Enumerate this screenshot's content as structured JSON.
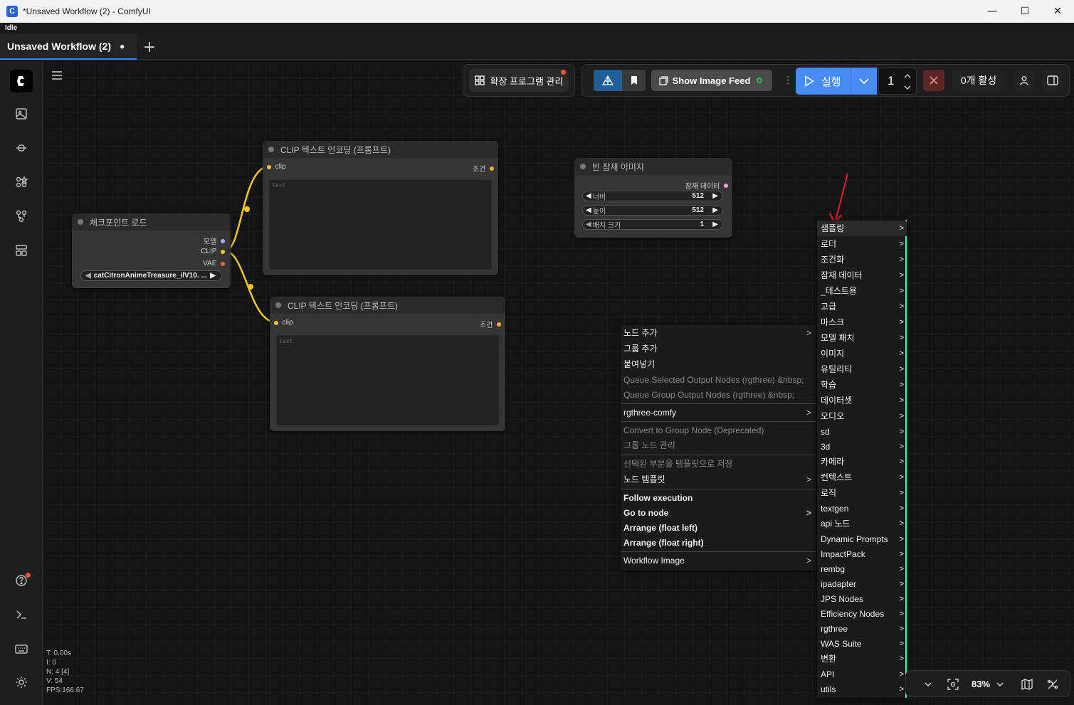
{
  "window": {
    "title": "*Unsaved Workflow (2) - ComfyUI",
    "app_icon": "C",
    "minimize": "—",
    "maximize": "☐",
    "close": "✕"
  },
  "status": "Idle",
  "tab": {
    "label": "Unsaved Workflow (2)",
    "modified_dot": "●",
    "add": "+"
  },
  "toolbar": {
    "extensions_label": "확장 프로그램 관리",
    "show_image_feed": "Show Image Feed",
    "run_label": "실행",
    "queue_count": "1",
    "active_label": "0개 활성"
  },
  "nodes": {
    "checkpoint": {
      "title": "체크포인트 로드",
      "outputs": [
        "모델",
        "CLIP",
        "VAE"
      ],
      "ckpt_name": "catCitronAnimeTreasure_ilV10. ..."
    },
    "clip1": {
      "title": "CLIP 텍스트 인코딩 (프롬프트)",
      "input": "clip",
      "output": "조건",
      "placeholder": "text"
    },
    "clip2": {
      "title": "CLIP 텍스트 인코딩 (프롬프트)",
      "input": "clip",
      "output": "조건",
      "placeholder": "text"
    },
    "latent": {
      "title": "빈 잠재 이미지",
      "output": "잠재 데이터",
      "widgets": [
        {
          "label": "너비",
          "value": "512"
        },
        {
          "label": "높이",
          "value": "512"
        },
        {
          "label": "배치 크기",
          "value": "1"
        }
      ]
    }
  },
  "context_menu": {
    "items": [
      {
        "label": "노드 추가",
        "submenu": true,
        "disabled": false
      },
      {
        "label": "그룹 추가",
        "submenu": false,
        "disabled": false
      },
      {
        "label": "붙여넣기",
        "submenu": false,
        "disabled": false
      },
      {
        "label": "Queue Selected Output Nodes (rgthree) &nbsp;",
        "submenu": false,
        "disabled": true
      },
      {
        "label": "Queue Group Output Nodes (rgthree) &nbsp;",
        "submenu": false,
        "disabled": true
      },
      {
        "label": "rgthree-comfy",
        "submenu": true,
        "disabled": false
      },
      {
        "label": "Convert to Group Node (Deprecated)",
        "submenu": false,
        "disabled": true
      },
      {
        "label": "그룹 노드 관리",
        "submenu": false,
        "disabled": true
      },
      {
        "label": "선택된 부분을 템플릿으로 저장",
        "submenu": false,
        "disabled": true
      },
      {
        "label": "노드 템플릿",
        "submenu": true,
        "disabled": false
      },
      {
        "label": "Follow execution",
        "submenu": false,
        "disabled": false
      },
      {
        "label": "Go to node",
        "submenu": true,
        "disabled": false
      },
      {
        "label": "Arrange (float left)",
        "submenu": false,
        "disabled": false
      },
      {
        "label": "Arrange (float right)",
        "submenu": false,
        "disabled": false
      },
      {
        "label": "Workflow Image",
        "submenu": true,
        "disabled": false
      }
    ]
  },
  "submenu": {
    "items": [
      "샘플링",
      "로더",
      "조건화",
      "잠재 데이터",
      "_테스트용",
      "고급",
      "마스크",
      "모델 패치",
      "이미지",
      "유틸리티",
      "학습",
      "데이터셋",
      "오디오",
      "sd",
      "3d",
      "카메라",
      "컨텍스트",
      "로직",
      "textgen",
      "api 노드",
      "Dynamic Prompts",
      "ImpactPack",
      "rembg",
      "ipadapter",
      "JPS Nodes",
      "Efficiency Nodes",
      "rgthree",
      "WAS Suite",
      "변환",
      "API",
      "utils"
    ]
  },
  "stats": {
    "t": "T: 0.00s",
    "i": "I: 0",
    "n": "N: 4 [4]",
    "v": "V: 54",
    "fps": "FPS:166.67"
  },
  "zoom": {
    "level": "83%"
  },
  "colors": {
    "link_clip": "#f5c518",
    "accent": "#3b82f6",
    "run_button": "#4a8cf7"
  }
}
